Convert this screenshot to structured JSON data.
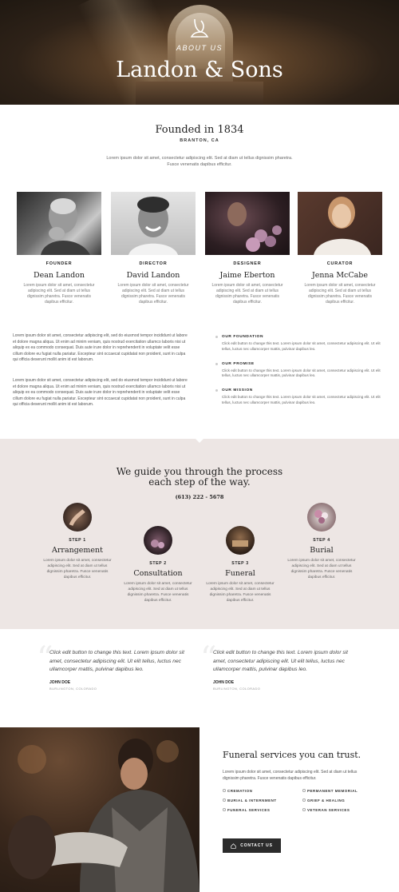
{
  "hero": {
    "label": "ABOUT US",
    "title": "Landon & Sons"
  },
  "founded": {
    "title": "Founded in 1834",
    "location": "BRANTON, CA",
    "description": "Lorem ipsum dolor sit amet, consectetur adipiscing elit. Sed at diam ut tellus dignissim pharetra. Fusce venenatis dapibus efficitur."
  },
  "team": [
    {
      "role": "FOUNDER",
      "name": "Dean Landon",
      "desc": "Lorem ipsum dolor sit amet, consectetur adipiscing elit. Sed at diam ut tellus dignissim pharetra. Fusce venenatis dapibus efficitur."
    },
    {
      "role": "DIRECTOR",
      "name": "David Landon",
      "desc": "Lorem ipsum dolor sit amet, consectetur adipiscing elit. Sed at diam ut tellus dignissim pharetra. Fusce venenatis dapibus efficitur."
    },
    {
      "role": "DESIGNER",
      "name": "Jaime Eberton",
      "desc": "Lorem ipsum dolor sit amet, consectetur adipiscing elit. Sed at diam ut tellus dignissim pharetra. Fusce venenatis dapibus efficitur."
    },
    {
      "role": "CURATOR",
      "name": "Jenna McCabe",
      "desc": "Lorem ipsum dolor sit amet, consectetur adipiscing elit. Sed at diam ut tellus dignissim pharetra. Fusce venenatis dapibus efficitur."
    }
  ],
  "about": {
    "paragraphs": [
      "Lorem ipsum dolor sit amet, consectetur adipiscing elit, sed do eiusmod tempor incididunt ut labore et dolore magna aliqua. Ut enim ad minim veniam, quis nostrud exercitation ullamco laboris nisi ut aliquip ex ea commodo consequat. Duis aute irure dolor in reprehenderit in voluptate velit esse cillum dolore eu fugiat nulla pariatur. Excepteur sint occaecat cupidatat non proident, sunt in culpa qui officia deserunt mollit anim id est laborum.",
      "Lorem ipsum dolor sit amet, consectetur adipiscing elit, sed do eiusmod tempor incididunt ut labore et dolore magna aliqua. Ut enim ad minim veniam, quis nostrud exercitation ullamco laboris nisi ut aliquip ex ea commodo consequat. Duis aute irure dolor in reprehenderit in voluptate velit esse cillum dolore eu fugiat nulla pariatur. Excepteur sint occaecat cupidatat non proident, sunt in culpa qui officia deserunt mollit anim id est laborum."
    ],
    "items": [
      {
        "title": "OUR FOUNDATION",
        "text": "Click edit button to change this text. Lorem ipsum dolor sit amet, consectetur adipiscing elit. Ut elit tellus, luctus nec ullamcorper mattis, pulvinar dapibus leo."
      },
      {
        "title": "OUR PROMISE",
        "text": "Click edit button to change this text. Lorem ipsum dolor sit amet, consectetur adipiscing elit. Ut elit tellus, luctus nec ullamcorper mattis, pulvinar dapibus leo."
      },
      {
        "title": "OUR MISSION",
        "text": "Click edit button to change this text. Lorem ipsum dolor sit amet, consectetur adipiscing elit. Ut elit tellus, luctus nec ullamcorper mattis, pulvinar dapibus leo."
      }
    ]
  },
  "process": {
    "title_line1": "We guide you through the process",
    "title_line2": "each step of the way.",
    "phone": "(613) 222 - 5678",
    "steps": [
      {
        "label": "STEP 1",
        "title": "Arrangement",
        "desc": "Lorem ipsum dolor sit amet, consectetur adipiscing elit. Sed at diam ut tellus dignissim pharetra. Fusce venenatis dapibus efficitur."
      },
      {
        "label": "STEP 2",
        "title": "Consultation",
        "desc": "Lorem ipsum dolor sit amet, consectetur adipiscing elit. Sed at diam ut tellus dignissim pharetra. Fusce venenatis dapibus efficitur."
      },
      {
        "label": "STEP 3",
        "title": "Funeral",
        "desc": "Lorem ipsum dolor sit amet, consectetur adipiscing elit. Sed at diam ut tellus dignissim pharetra. Fusce venenatis dapibus efficitur."
      },
      {
        "label": "STEP 4",
        "title": "Burial",
        "desc": "Lorem ipsum dolor sit amet, consectetur adipiscing elit. Sed at diam ut tellus dignissim pharetra. Fusce venenatis dapibus efficitur."
      }
    ]
  },
  "testimonials": [
    {
      "text": "Click edit button to change this text. Lorem ipsum dolor sit amet, consectetur adipiscing elit. Ut elit tellus, luctus nec ullamcorper mattis, pulvinar dapibus leo.",
      "name": "JOHN DOE",
      "location": "BURLINGTON, COLORADO"
    },
    {
      "text": "Click edit button to change this text. Lorem ipsum dolor sit amet, consectetur adipiscing elit. Ut elit tellus, luctus nec ullamcorper mattis, pulvinar dapibus leo.",
      "name": "JOHN DOE",
      "location": "BURLINGTON, COLORADO"
    }
  ],
  "services": {
    "title": "Funeral services you can trust.",
    "description": "Lorem ipsum dolor sit amet, consectetur adipiscing elit. Sed at diam ut tellus dignissim pharetra. Fusce venenatis dapibus efficitur.",
    "items": [
      "CREMATION",
      "PERMANENT MEMORIAL",
      "BURIAL & INTERNMENT",
      "GRIEF & HEALING",
      "FUNERAL SERVICES",
      "VETERAN SERVICES"
    ],
    "cta": "CONTACT US"
  },
  "colors": {
    "accent": "#2b2b2b",
    "process_bg": "#ede6e4"
  },
  "icons": {
    "logo": "leaf-logo-icon",
    "quote": "quote-icon",
    "cta": "home-icon"
  }
}
